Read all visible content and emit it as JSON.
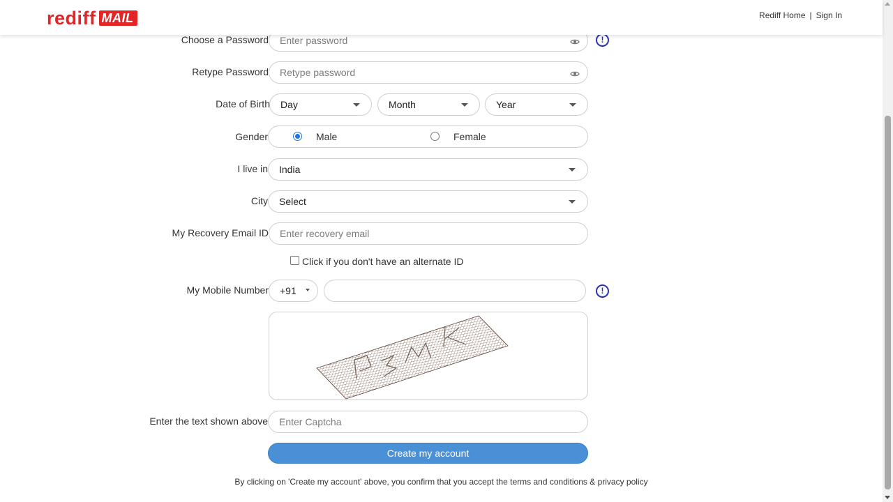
{
  "header": {
    "logo_text": "rediff",
    "logo_badge": "MAIL",
    "links": {
      "home": "Rediff Home",
      "separator": "|",
      "sign_in": "Sign In"
    }
  },
  "form": {
    "password": {
      "label": "Choose a Password",
      "placeholder": "Enter password",
      "icon": "eye-icon",
      "info_icon": "info-icon"
    },
    "retype_password": {
      "label": "Retype Password",
      "placeholder": "Retype password",
      "icon": "eye-icon"
    },
    "dob": {
      "label": "Date of Birth",
      "day": "Day",
      "month": "Month",
      "year": "Year"
    },
    "gender": {
      "label": "Gender",
      "male": "Male",
      "female": "Female",
      "selected": "Male"
    },
    "country": {
      "label": "I live in",
      "value": "India"
    },
    "city": {
      "label": "City",
      "value": "Select"
    },
    "recovery_email": {
      "label": "My Recovery Email ID",
      "placeholder": "Enter recovery email"
    },
    "no_alternate": {
      "label": "Click if you don't have an alternate ID",
      "checked": false
    },
    "mobile": {
      "label": "My Mobile Number",
      "country_code": "+91",
      "value": "",
      "info_icon": "info-icon"
    },
    "captcha": {
      "image_text": "P3WK",
      "label": "Enter the text shown above",
      "placeholder": "Enter Captcha"
    },
    "submit_label": "Create my account",
    "terms_text": "By clicking on 'Create my account' above, you confirm that you accept the terms and conditions & privacy policy"
  },
  "colors": {
    "brand_red": "#e42526",
    "button_blue": "#4a90d6",
    "info_blue": "#2a2fbf",
    "radio_blue": "#1a73e8"
  }
}
